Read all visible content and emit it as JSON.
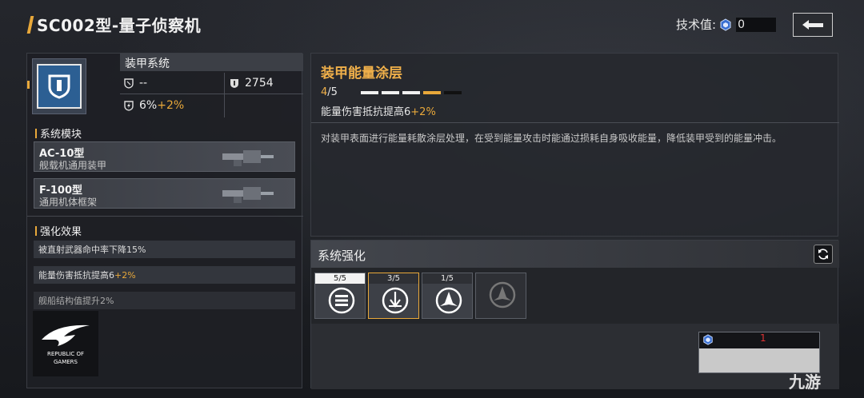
{
  "header": {
    "title": "SC002型-量子侦察机",
    "tech_label": "技术值:",
    "tech_value": "0"
  },
  "armor": {
    "name": "装甲系统",
    "stat1_value": "--",
    "stat2_value": "2754",
    "stat3_value": "6%",
    "stat3_bonus": "+2%"
  },
  "modules": {
    "section_title": "系统模块",
    "items": [
      {
        "name": "AC-10型",
        "sub": "舰载机通用装甲"
      },
      {
        "name": "F-100型",
        "sub": "通用机体框架"
      }
    ]
  },
  "effects": {
    "section_title": "强化效果",
    "items": [
      {
        "text": "被直射武器命中率下降15%",
        "bonus": ""
      },
      {
        "text": "能量伤害抵抗提高6",
        "bonus": "+2%"
      },
      {
        "text": "舰船结构值提升2%",
        "bonus": ""
      }
    ]
  },
  "logo": {
    "line1": "REPUBLIC OF",
    "line2": "GAMERS"
  },
  "detail": {
    "title": "装甲能量涂层",
    "level_current": "4",
    "level_max": "/5",
    "pips": [
      1,
      1,
      1,
      2,
      0
    ],
    "effect": "能量伤害抵抗提高6",
    "effect_bonus": "+2%",
    "description": "对装甲表面进行能量耗散涂层处理，在受到能量攻击时能通过损耗自身吸收能量，降低装甲受到的能量冲击。"
  },
  "system": {
    "title": "系统强化",
    "slots": [
      {
        "level": "5/5",
        "icon": "armor-layers-icon"
      },
      {
        "level": "3/5",
        "icon": "energy-shield-icon"
      },
      {
        "level": "1/5",
        "icon": "fighter-emblem-icon"
      },
      {
        "level": "",
        "icon": "locked-emblem-icon"
      }
    ],
    "cost_value": "1"
  },
  "watermark": "九游",
  "colors": {
    "accent": "#e8a83a",
    "cost_red": "#d33333",
    "icon_blue": "#2c5f93"
  }
}
